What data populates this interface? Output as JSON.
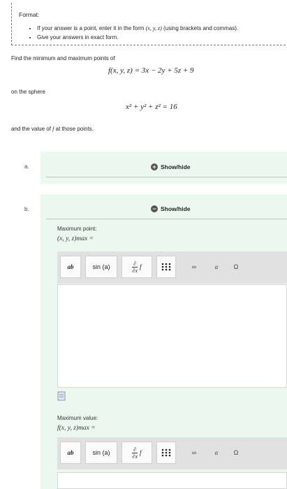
{
  "format": {
    "title": "Format:",
    "bullet1_pre": "If your answer is a point, enter it in the form",
    "bullet1_math": "(x, y, z)",
    "bullet1_post": "(using brackets and commas).",
    "bullet2": "Give your answers in exact form."
  },
  "problem": {
    "intro": "Find the minimum and maximum points of",
    "function": "f(x, y, z) = 3x − 2y + 5z + 9",
    "on_sphere": "on the sphere",
    "sphere": "x² + y² + z² = 16",
    "value_pre": "and the value of",
    "value_f": "f",
    "value_post": "at those points."
  },
  "part_a": {
    "label": "a.",
    "toggle": "Show/hide",
    "toggle_icon": "plus-icon",
    "state": "collapsed"
  },
  "part_b": {
    "label": "b.",
    "toggle": "Show/hide",
    "toggle_icon": "minus-icon",
    "state": "expanded",
    "max_point_label": "Maximum point:",
    "max_point_expr": "(x, y, z)max =",
    "max_value_label": "Maximum value:",
    "max_value_expr": "f(x, y, z)max ="
  },
  "toolbar": {
    "superscript": "ab",
    "function": "sin (a)",
    "derivative_num": "∂",
    "derivative_den": "∂x",
    "derivative_f": "f",
    "matrix": "⋮⋮⋮",
    "infinity": "∞",
    "greek": "α",
    "symbols": "Ω"
  },
  "colors": {
    "panel_bg": "#ecf8ee",
    "toolbar_bg": "#e1e1e1",
    "icon_dark": "#555555"
  }
}
